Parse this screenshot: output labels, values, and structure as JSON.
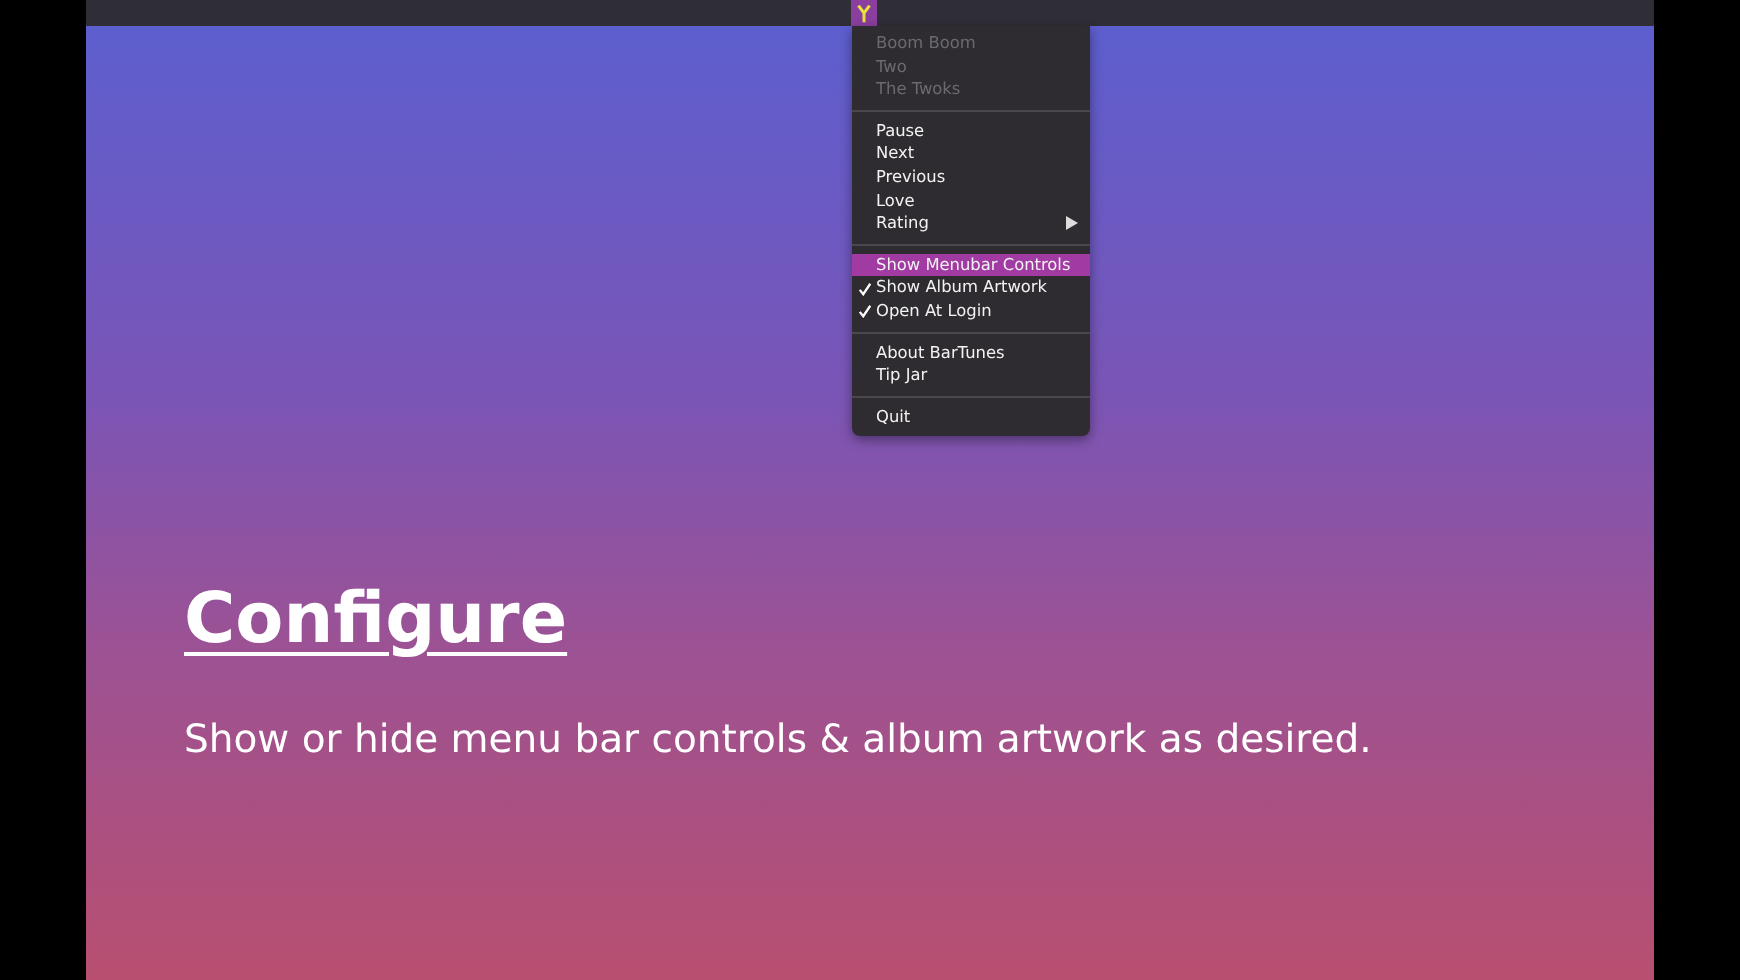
{
  "menu": {
    "sections": [
      {
        "items": [
          {
            "label": "Boom Boom",
            "kind": "command",
            "disabled": true,
            "checked": false,
            "selected": false
          },
          {
            "label": "Two",
            "kind": "command",
            "disabled": true,
            "checked": false,
            "selected": false
          },
          {
            "label": "The Twoks",
            "kind": "command",
            "disabled": true,
            "checked": false,
            "selected": false
          }
        ]
      },
      {
        "items": [
          {
            "label": "Pause",
            "kind": "command",
            "disabled": false,
            "checked": false,
            "selected": false
          },
          {
            "label": "Next",
            "kind": "command",
            "disabled": false,
            "checked": false,
            "selected": false
          },
          {
            "label": "Previous",
            "kind": "command",
            "disabled": false,
            "checked": false,
            "selected": false
          },
          {
            "label": "Love",
            "kind": "command",
            "disabled": false,
            "checked": false,
            "selected": false
          },
          {
            "label": "Rating",
            "kind": "submenu",
            "disabled": false,
            "checked": false,
            "selected": false
          }
        ]
      },
      {
        "items": [
          {
            "label": "Show Menubar Controls",
            "kind": "command",
            "disabled": false,
            "checked": false,
            "selected": true
          },
          {
            "label": "Show Album Artwork",
            "kind": "command",
            "disabled": false,
            "checked": true,
            "selected": false
          },
          {
            "label": "Open At Login",
            "kind": "command",
            "disabled": false,
            "checked": true,
            "selected": false
          }
        ]
      },
      {
        "items": [
          {
            "label": "About BarTunes",
            "kind": "command",
            "disabled": false,
            "checked": false,
            "selected": false
          },
          {
            "label": "Tip Jar",
            "kind": "command",
            "disabled": false,
            "checked": false,
            "selected": false
          }
        ]
      },
      {
        "items": [
          {
            "label": "Quit",
            "kind": "command",
            "disabled": false,
            "checked": false,
            "selected": false
          }
        ]
      }
    ]
  },
  "heading": "Configure",
  "description": "Show or hide menu bar controls & album artwork as desired."
}
